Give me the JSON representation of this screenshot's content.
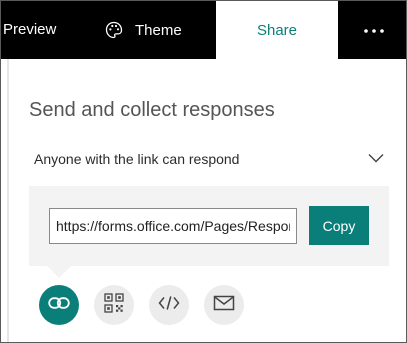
{
  "tabs": {
    "preview": "Preview",
    "theme": "Theme",
    "share": "Share"
  },
  "icons": {
    "theme": "palette-icon",
    "more": "more-icon",
    "dropdown": "chevron-down-icon",
    "link": "link-icon",
    "qr": "qr-code-icon",
    "embed": "embed-code-icon",
    "email": "mail-icon"
  },
  "share_panel": {
    "heading": "Send and collect responses",
    "access_option": "Anyone with the link can respond",
    "link_value": "https://forms.office.com/Pages/Respor",
    "copy_label": "Copy",
    "active_method": "link"
  },
  "colors": {
    "accent": "#0a7f7a",
    "topbar": "#000000",
    "panel": "#f3f3f3"
  }
}
